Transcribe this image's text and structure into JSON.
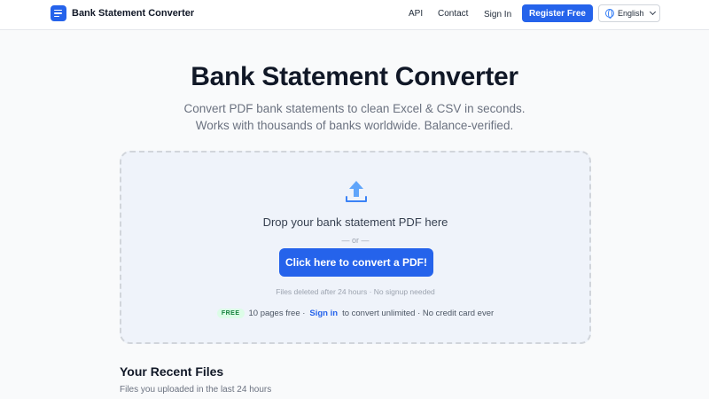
{
  "header": {
    "brand": "Bank Statement Converter",
    "nav": {
      "api": "API",
      "contact": "Contact",
      "sign_in": "Sign In"
    },
    "register": "Register Free",
    "language": "English"
  },
  "hero": {
    "title": "Bank Statement Converter",
    "subtitle_line1": "Convert PDF bank statements to clean Excel & CSV in seconds.",
    "subtitle_line2": "Works with thousands of banks worldwide. Balance-verified."
  },
  "dropzone": {
    "title": "Drop your bank statement PDF here",
    "or": "— or —",
    "button": "Click here to convert a PDF!",
    "note": "Files deleted after 24 hours · No signup needed",
    "free_badge": "FREE",
    "free_text": "10 pages free ·",
    "sign_in_link": "Sign in",
    "free_suffix": "to convert unlimited · No credit card ever"
  },
  "recent": {
    "title": "Your Recent Files",
    "subtitle": "Files you uploaded in the last 24 hours"
  },
  "colors": {
    "accent": "#2563eb",
    "free_badge_bg": "#dcfce7",
    "free_badge_text": "#15803d"
  },
  "icons": {
    "logo": "document-lines-icon",
    "language": "globe-icon",
    "language_caret": "chevron-down-icon",
    "upload": "upload-arrow-icon"
  }
}
